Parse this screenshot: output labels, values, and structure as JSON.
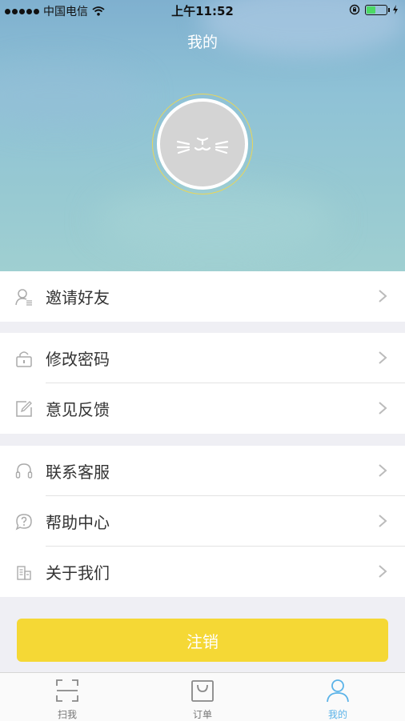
{
  "status_bar": {
    "carrier": "中国电信",
    "time": "上午11:52"
  },
  "header": {
    "title": "我的"
  },
  "menu": {
    "invite": "邀请好友",
    "change_password": "修改密码",
    "feedback": "意见反馈",
    "contact_service": "联系客服",
    "help_center": "帮助中心",
    "about_us": "关于我们"
  },
  "logout_label": "注销",
  "tabs": [
    {
      "label": "扫我",
      "icon": "scan-icon"
    },
    {
      "label": "订单",
      "icon": "shopping-bag-icon"
    },
    {
      "label": "我的",
      "icon": "person-icon"
    }
  ],
  "colors": {
    "accent": "#f5d835",
    "tab_active": "#5bb3e8",
    "battery": "#4cd964"
  }
}
